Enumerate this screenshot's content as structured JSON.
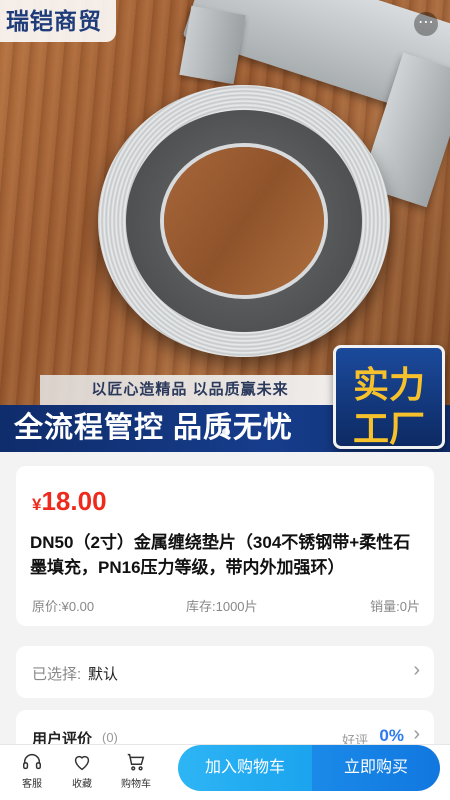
{
  "hero": {
    "brand": "瑞铠商贸",
    "more_icon": "more-icon",
    "slogan_small": "以匠心造精品 以品质赢未来",
    "slogan_big": "全流程管控 品质无忧",
    "badge_line1": "实力",
    "badge_line2": "工厂"
  },
  "product": {
    "currency": "¥",
    "price": "18.00",
    "title": "DN50（2寸）金属缠绕垫片（304不锈钢带+柔性石墨填充，PN16压力等级，带内外加强环）",
    "original_price": "原价:¥0.00",
    "stock": "库存:1000片",
    "sales": "销量:0片"
  },
  "selection": {
    "label": "已选择:",
    "value": "默认",
    "chevron": "›"
  },
  "reviews": {
    "label": "用户评价",
    "count": "(0)",
    "good_label": "好评",
    "good_pct": "0%",
    "chevron": "›"
  },
  "bottom_bar": {
    "customer_service": "客服",
    "favorite": "收藏",
    "cart": "购物车",
    "add_to_cart": "加入购物车",
    "buy_now": "立即购买"
  },
  "colors": {
    "price_red": "#ee2a1d",
    "accent_blue": "#1a8ae8",
    "banner_navy": "#0f2c6b",
    "badge_gold": "#f6c12b"
  }
}
